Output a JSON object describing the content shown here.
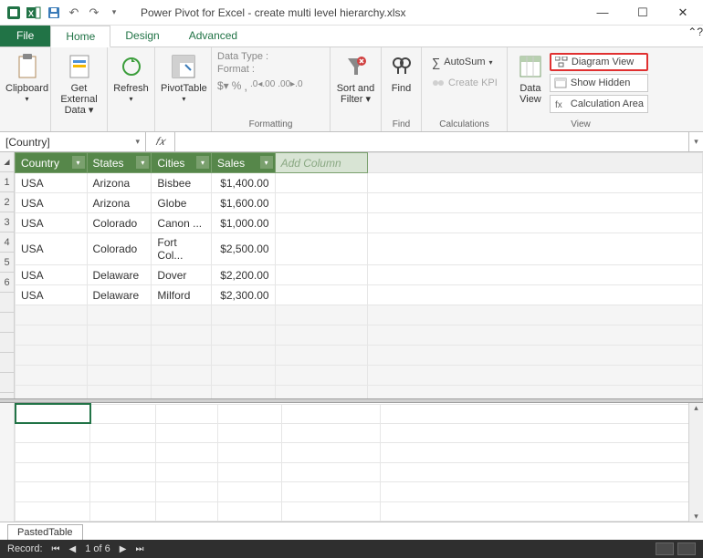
{
  "window": {
    "title": "Power Pivot for Excel - create multi level hierarchy.xlsx"
  },
  "tabs": {
    "file": "File",
    "home": "Home",
    "design": "Design",
    "advanced": "Advanced"
  },
  "ribbon": {
    "clipboard": {
      "label": "Clipboard",
      "btn": "Clipboard"
    },
    "getdata": {
      "btn": "Get External\nData"
    },
    "refresh": {
      "btn": "Refresh"
    },
    "pivot": {
      "btn": "PivotTable"
    },
    "formatting": {
      "label": "Formatting",
      "datatype": "Data Type :",
      "format": "Format :"
    },
    "sortfilter": {
      "btn": "Sort and\nFilter",
      "label": ""
    },
    "find": {
      "btn": "Find",
      "label": "Find"
    },
    "calc": {
      "autosum": "AutoSum",
      "createkpi": "Create KPI",
      "label": "Calculations"
    },
    "view": {
      "dataview": "Data\nView",
      "diagram": "Diagram View",
      "hidden": "Show Hidden",
      "calcarea": "Calculation Area",
      "label": "View"
    }
  },
  "formula_bar": {
    "namebox": "[Country]"
  },
  "columns": [
    "Country",
    "States",
    "Cities",
    "Sales"
  ],
  "add_column": "Add Column",
  "rows": [
    {
      "n": 1,
      "country": "USA",
      "state": "Arizona",
      "city": "Bisbee",
      "sales": "$1,400.00"
    },
    {
      "n": 2,
      "country": "USA",
      "state": "Arizona",
      "city": "Globe",
      "sales": "$1,600.00"
    },
    {
      "n": 3,
      "country": "USA",
      "state": "Colorado",
      "city": "Canon ...",
      "sales": "$1,000.00"
    },
    {
      "n": 4,
      "country": "USA",
      "state": "Colorado",
      "city": "Fort Col...",
      "sales": "$2,500.00"
    },
    {
      "n": 5,
      "country": "USA",
      "state": "Delaware",
      "city": "Dover",
      "sales": "$2,200.00"
    },
    {
      "n": 6,
      "country": "USA",
      "state": "Delaware",
      "city": "Milford",
      "sales": "$2,300.00"
    }
  ],
  "sheet_tab": "PastedTable",
  "status": {
    "record": "Record:",
    "pos": "1 of 6"
  }
}
